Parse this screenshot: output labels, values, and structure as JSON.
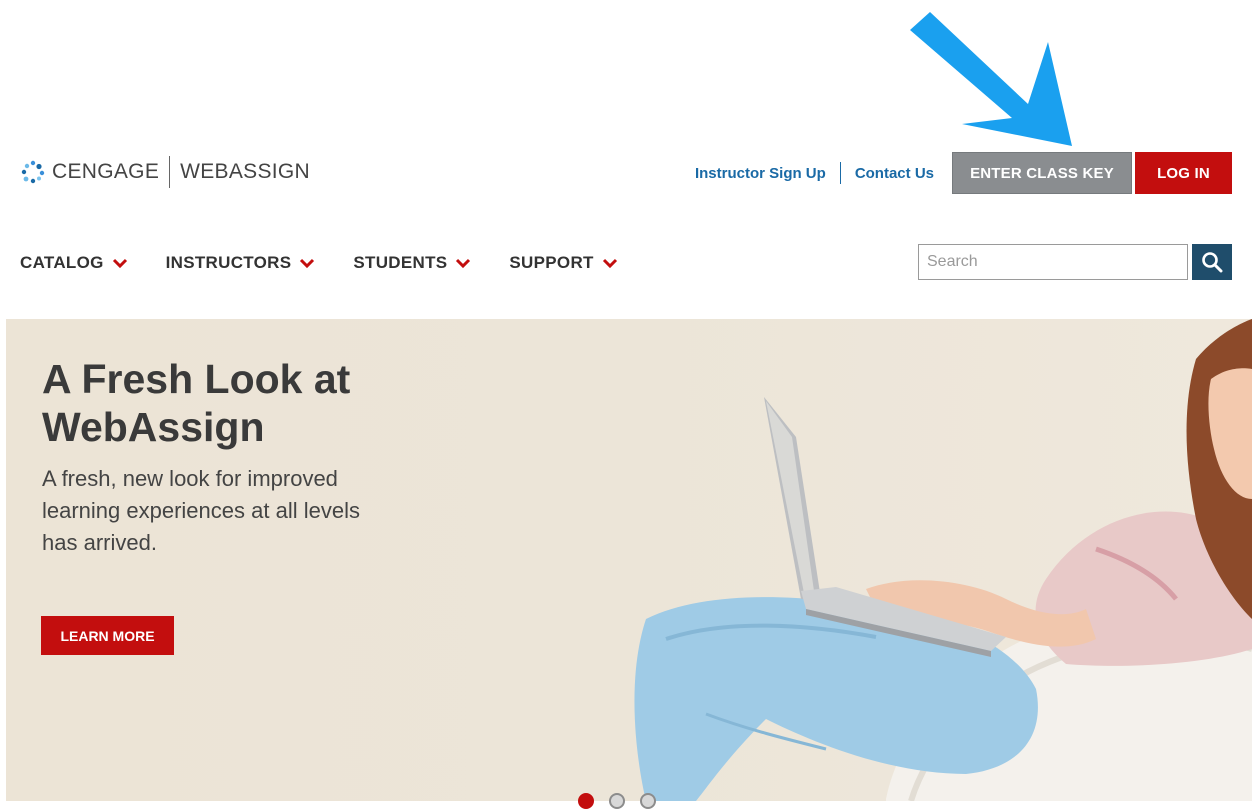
{
  "logo": {
    "brand": "CENGAGE",
    "product": "WEBASSIGN"
  },
  "top_links": {
    "instructor_sign_up": "Instructor Sign Up",
    "contact_us": "Contact Us"
  },
  "buttons": {
    "enter_class_key": "ENTER CLASS KEY",
    "log_in": "LOG IN"
  },
  "nav": {
    "items": [
      {
        "label": "CATALOG"
      },
      {
        "label": "INSTRUCTORS"
      },
      {
        "label": "STUDENTS"
      },
      {
        "label": "SUPPORT"
      }
    ]
  },
  "search": {
    "placeholder": "Search"
  },
  "hero": {
    "title": "A Fresh Look at WebAssign",
    "description": "A fresh, new look for improved learning experiences at all levels has arrived.",
    "cta": "LEARN MORE"
  },
  "carousel": {
    "slide_count": 3,
    "active_index": 0
  },
  "colors": {
    "accent_red": "#c30e0e",
    "link_blue": "#1a6aa6",
    "arrow_blue": "#1aa0ef",
    "search_button": "#1f4d6b"
  }
}
